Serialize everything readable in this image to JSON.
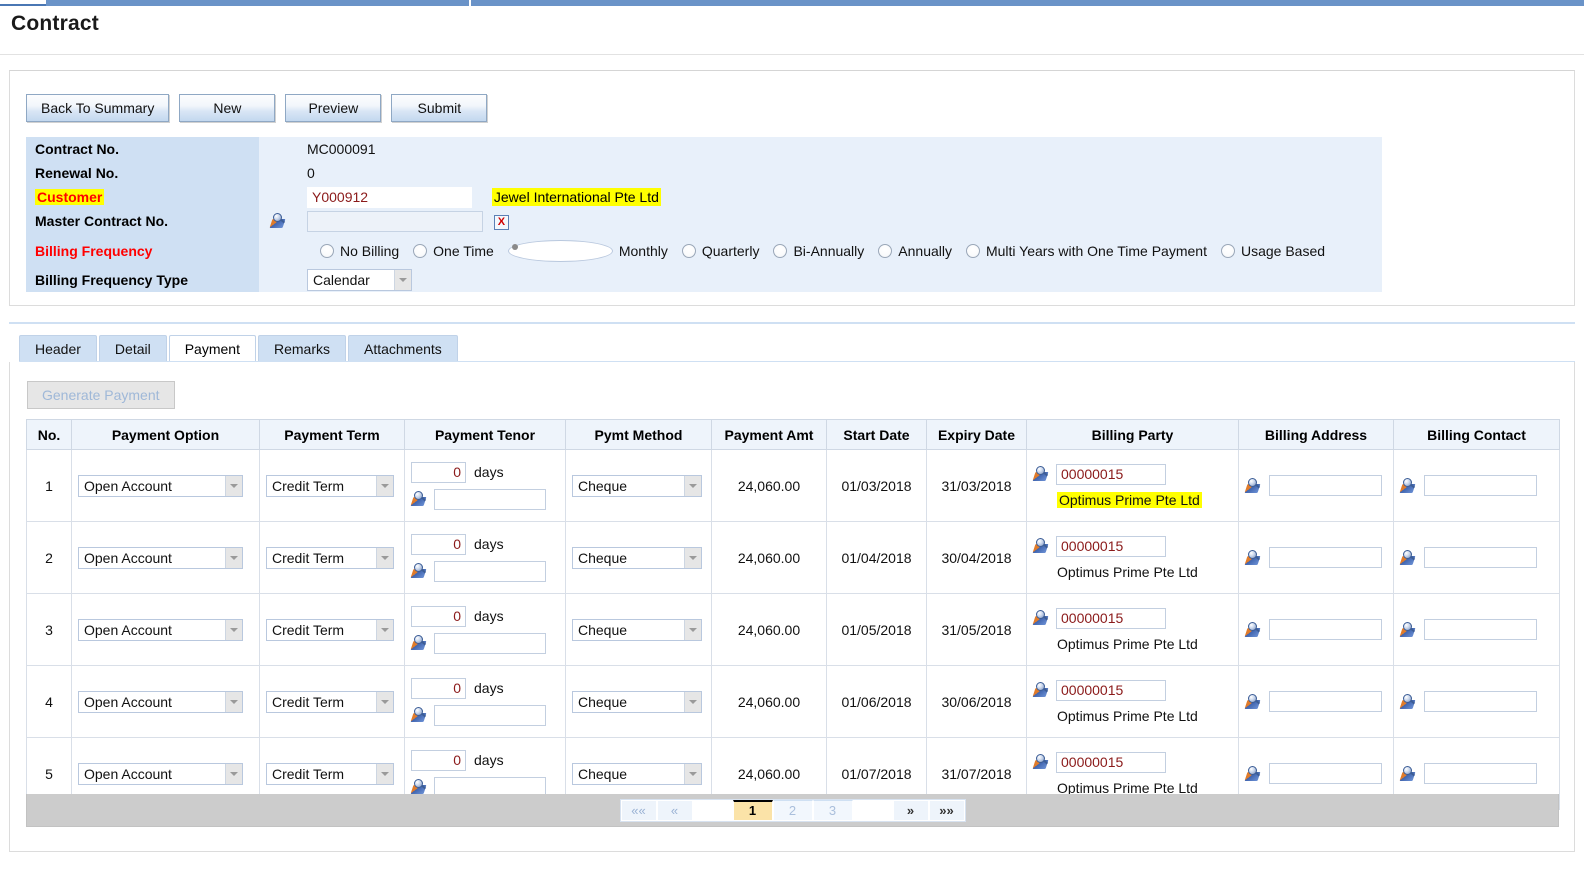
{
  "page": {
    "title": "Contract"
  },
  "toolbar": {
    "buttons": [
      {
        "label": "Back To Summary",
        "name": "back-to-summary-button"
      },
      {
        "label": "New",
        "name": "new-button"
      },
      {
        "label": "Preview",
        "name": "preview-button"
      },
      {
        "label": "Submit",
        "name": "submit-button"
      }
    ]
  },
  "header_fields": {
    "contract_no": {
      "label": "Contract No.",
      "value": "MC000091"
    },
    "renewal_no": {
      "label": "Renewal No.",
      "value": "0"
    },
    "customer": {
      "label": "Customer",
      "code": "Y000912",
      "name": "Jewel International Pte Ltd",
      "lookup_icon": "lookup-icon"
    },
    "master_contract_no": {
      "label": "Master Contract No.",
      "value": "",
      "lookup_icon": "lookup-icon",
      "clear_icon": "X"
    },
    "billing_frequency": {
      "label": "Billing Frequency",
      "selected": "Monthly",
      "options": [
        "No Billing",
        "One Time",
        "Monthly",
        "Quarterly",
        "Bi-Annually",
        "Annually",
        "Multi Years with One Time Payment",
        "Usage Based"
      ]
    },
    "billing_frequency_type": {
      "label": "Billing Frequency Type",
      "value": "Calendar"
    }
  },
  "tabs": {
    "items": [
      {
        "label": "Header",
        "name": "tab-header",
        "active": false
      },
      {
        "label": "Detail",
        "name": "tab-detail",
        "active": false
      },
      {
        "label": "Payment",
        "name": "tab-payment",
        "active": true
      },
      {
        "label": "Remarks",
        "name": "tab-remarks",
        "active": false
      },
      {
        "label": "Attachments",
        "name": "tab-attachments",
        "active": false
      }
    ]
  },
  "payment_panel": {
    "generate_button": "Generate Payment",
    "columns": [
      "No.",
      "Payment Option",
      "Payment Term",
      "Payment Tenor",
      "Pymt Method",
      "Payment Amt",
      "Start Date",
      "Expiry Date",
      "Billing Party",
      "Billing Address",
      "Billing Contact"
    ],
    "tenor_unit": "days",
    "rows": [
      {
        "no": "1",
        "payment_option": "Open Account",
        "payment_term": "Credit Term",
        "payment_tenor": "0",
        "payment_tenor_lookup": "",
        "pymt_method": "Cheque",
        "payment_amt": "24,060.00",
        "start_date": "01/03/2018",
        "expiry_date": "31/03/2018",
        "billing_party_code": "00000015",
        "billing_party_name": "Optimus Prime Pte Ltd",
        "billing_party_highlighted": true,
        "billing_address": "",
        "billing_contact": ""
      },
      {
        "no": "2",
        "payment_option": "Open Account",
        "payment_term": "Credit Term",
        "payment_tenor": "0",
        "payment_tenor_lookup": "",
        "pymt_method": "Cheque",
        "payment_amt": "24,060.00",
        "start_date": "01/04/2018",
        "expiry_date": "30/04/2018",
        "billing_party_code": "00000015",
        "billing_party_name": "Optimus Prime Pte Ltd",
        "billing_party_highlighted": false,
        "billing_address": "",
        "billing_contact": ""
      },
      {
        "no": "3",
        "payment_option": "Open Account",
        "payment_term": "Credit Term",
        "payment_tenor": "0",
        "payment_tenor_lookup": "",
        "pymt_method": "Cheque",
        "payment_amt": "24,060.00",
        "start_date": "01/05/2018",
        "expiry_date": "31/05/2018",
        "billing_party_code": "00000015",
        "billing_party_name": "Optimus Prime Pte Ltd",
        "billing_party_highlighted": false,
        "billing_address": "",
        "billing_contact": ""
      },
      {
        "no": "4",
        "payment_option": "Open Account",
        "payment_term": "Credit Term",
        "payment_tenor": "0",
        "payment_tenor_lookup": "",
        "pymt_method": "Cheque",
        "payment_amt": "24,060.00",
        "start_date": "01/06/2018",
        "expiry_date": "30/06/2018",
        "billing_party_code": "00000015",
        "billing_party_name": "Optimus Prime Pte Ltd",
        "billing_party_highlighted": false,
        "billing_address": "",
        "billing_contact": ""
      },
      {
        "no": "5",
        "payment_option": "Open Account",
        "payment_term": "Credit Term",
        "payment_tenor": "0",
        "payment_tenor_lookup": "",
        "pymt_method": "Cheque",
        "payment_amt": "24,060.00",
        "start_date": "01/07/2018",
        "expiry_date": "31/07/2018",
        "billing_party_code": "00000015",
        "billing_party_name": "Optimus Prime Pte Ltd",
        "billing_party_highlighted": false,
        "billing_address": "",
        "billing_contact": ""
      }
    ]
  },
  "pager": {
    "first_label": "««",
    "prev_label": "«",
    "next_label": "»",
    "last_label": "»»",
    "pages": [
      "1",
      "2",
      "3"
    ],
    "current_page": "1"
  },
  "colors": {
    "label_bg": "#cfe0f3",
    "value_bg": "#e8f0fa",
    "required_text": "#ff0000",
    "highlight": "#ffff00",
    "input_text": "#8b1a1a",
    "active_page_bg": "#fbe3a8",
    "pager_bar_bg": "#cccccc"
  }
}
